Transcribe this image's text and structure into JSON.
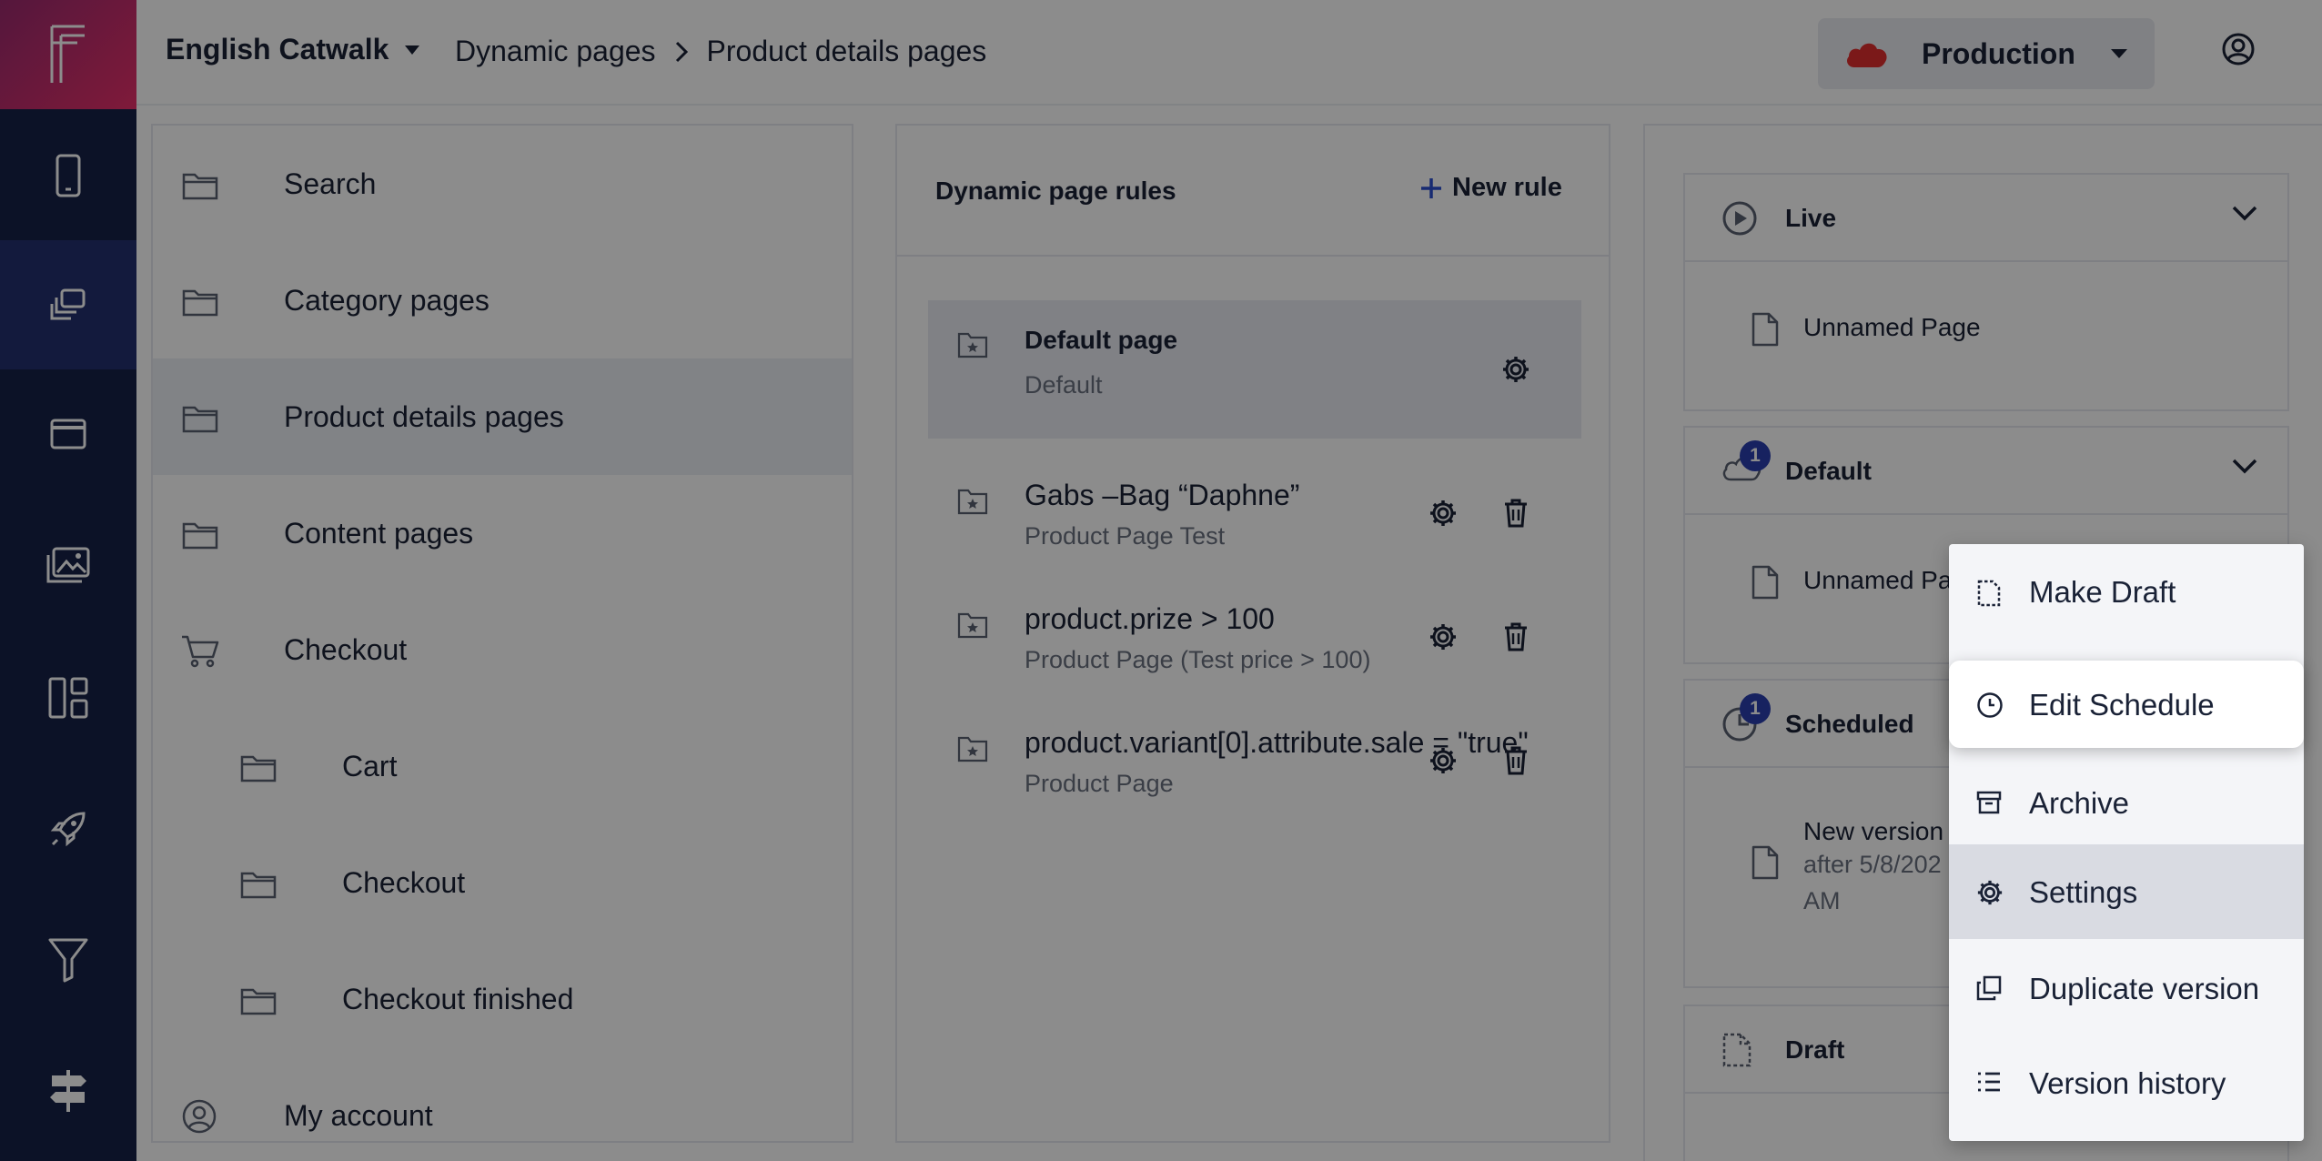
{
  "header": {
    "site_name": "English Catwalk",
    "breadcrumb": [
      "Dynamic pages",
      "Product details pages"
    ],
    "environment": "Production",
    "colors": {
      "environment_icon": "#e02e2e",
      "logo_gradient_start": "#9a2a6e",
      "logo_gradient_end": "#e8306a",
      "rail_bg": "#172147"
    }
  },
  "rail": {
    "items": [
      {
        "icon": "mobile-icon",
        "active": false
      },
      {
        "icon": "pages-icon",
        "active": true
      },
      {
        "icon": "window-icon",
        "active": false
      },
      {
        "icon": "images-icon",
        "active": false
      },
      {
        "icon": "layout-icon",
        "active": false
      },
      {
        "icon": "rocket-icon",
        "active": false
      },
      {
        "icon": "filter-icon",
        "active": false
      },
      {
        "icon": "signpost-icon",
        "active": false
      }
    ]
  },
  "tree": {
    "items": [
      {
        "label": "Search",
        "icon": "folder-icon",
        "level": 0,
        "selected": false
      },
      {
        "label": "Category pages",
        "icon": "folder-icon",
        "level": 0,
        "selected": false
      },
      {
        "label": "Product details pages",
        "icon": "folder-icon",
        "level": 0,
        "selected": true
      },
      {
        "label": "Content pages",
        "icon": "folder-icon",
        "level": 0,
        "selected": false
      },
      {
        "label": "Checkout",
        "icon": "cart-icon",
        "level": 0,
        "selected": false
      },
      {
        "label": "Cart",
        "icon": "folder-icon",
        "level": 1,
        "selected": false
      },
      {
        "label": "Checkout",
        "icon": "folder-icon",
        "level": 1,
        "selected": false
      },
      {
        "label": "Checkout finished",
        "icon": "folder-icon",
        "level": 1,
        "selected": false
      },
      {
        "label": "My account",
        "icon": "account-icon",
        "level": 0,
        "selected": false
      }
    ]
  },
  "rules": {
    "title": "Dynamic page rules",
    "new_rule_label": "New rule",
    "items": [
      {
        "title": "Default page",
        "subtitle": "Default",
        "selected": true,
        "deletable": false
      },
      {
        "title": "Gabs –Bag “Daphne”",
        "subtitle": "Product Page Test",
        "selected": false,
        "deletable": true
      },
      {
        "title": "product.prize > 100",
        "subtitle": "Product Page (Test price > 100)",
        "selected": false,
        "deletable": true
      },
      {
        "title": "product.variant[0].attribute.sale = \"true\"",
        "subtitle": "Product Page",
        "selected": false,
        "deletable": true
      }
    ]
  },
  "versions": {
    "live": {
      "title": "Live",
      "page": "Unnamed Page"
    },
    "default": {
      "title": "Default",
      "badge": "1",
      "page": "Unnamed Page"
    },
    "scheduled": {
      "title": "Scheduled",
      "badge": "1",
      "page_line1": "New version",
      "page_line2": "after 5/8/202",
      "page_line3": "AM"
    },
    "draft": {
      "title": "Draft"
    }
  },
  "context_menu": {
    "items": [
      {
        "label": "Make Draft",
        "icon": "draft-icon"
      },
      {
        "label": "Edit Schedule",
        "icon": "clock-icon"
      },
      {
        "label": "Archive",
        "icon": "archive-icon"
      },
      {
        "label": "Settings",
        "icon": "gear-icon"
      },
      {
        "label": "Duplicate version",
        "icon": "duplicate-icon"
      },
      {
        "label": "Version history",
        "icon": "list-icon"
      }
    ],
    "highlighted": "Edit Schedule",
    "hovered": "Settings"
  }
}
